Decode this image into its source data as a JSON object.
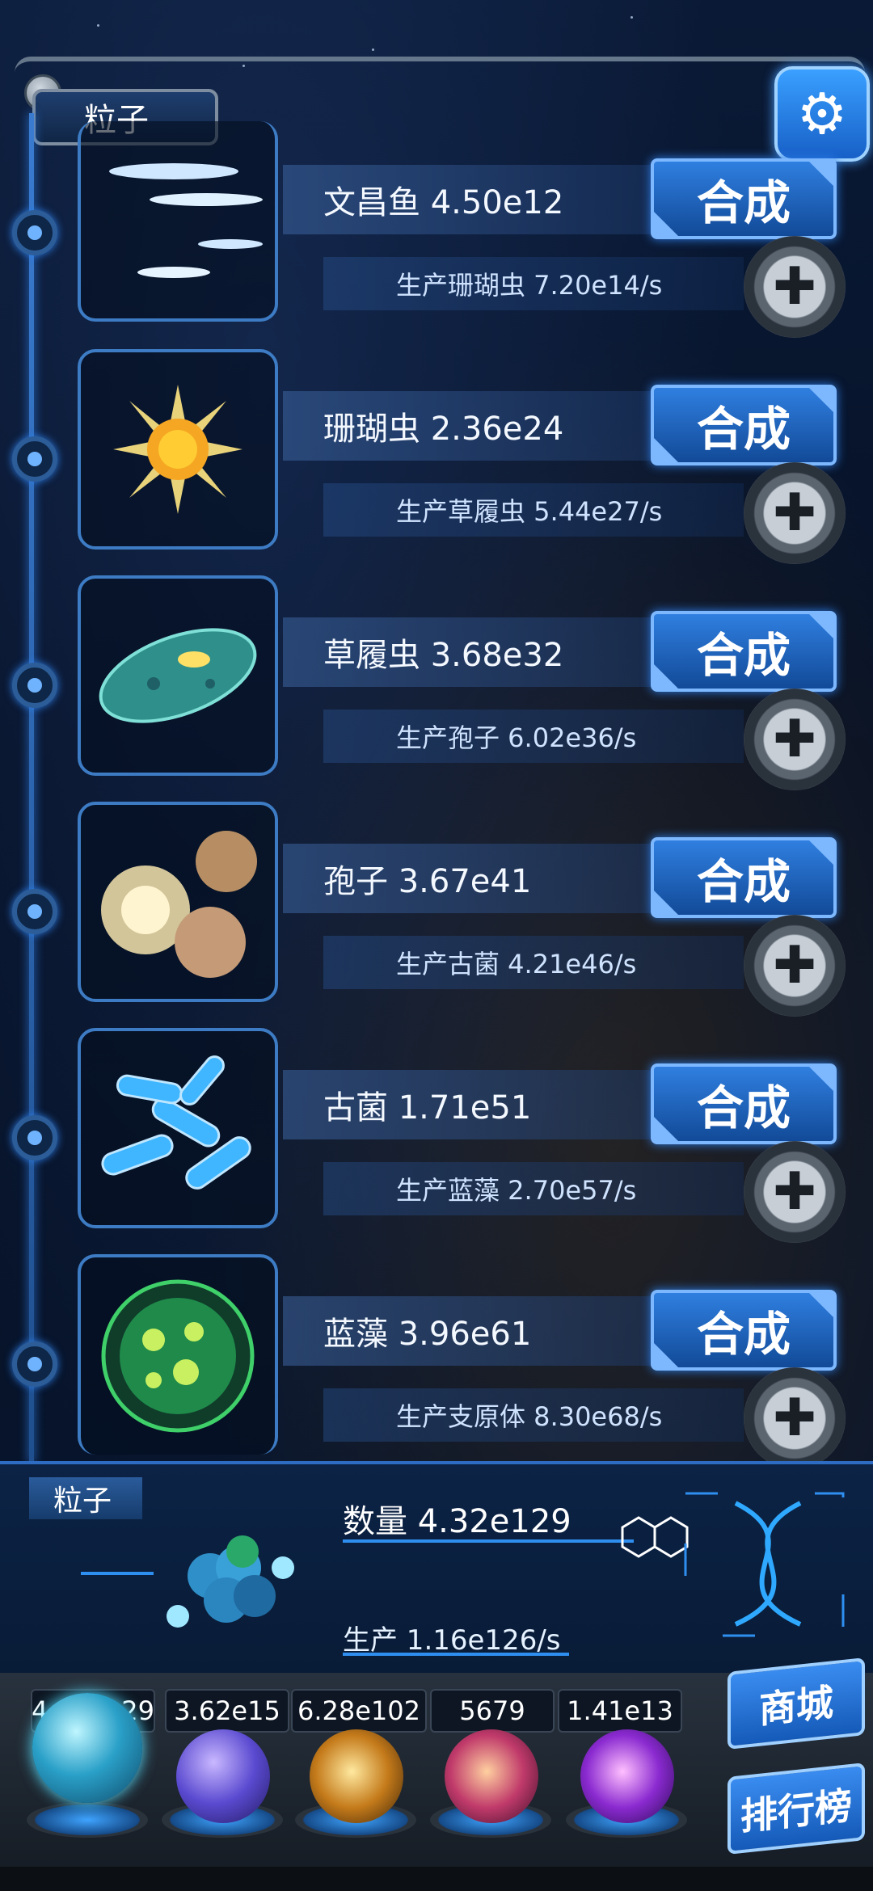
{
  "header": {
    "title": "粒子"
  },
  "rows": [
    {
      "name": "文昌鱼 4.50e12",
      "craft": "合成",
      "prod": "生产珊瑚虫 7.20e14/s"
    },
    {
      "name": "珊瑚虫 2.36e24",
      "craft": "合成",
      "prod": "生产草履虫 5.44e27/s"
    },
    {
      "name": "草履虫 3.68e32",
      "craft": "合成",
      "prod": "生产孢子 6.02e36/s"
    },
    {
      "name": "孢子 3.67e41",
      "craft": "合成",
      "prod": "生产古菌 4.21e46/s"
    },
    {
      "name": "古菌 1.71e51",
      "craft": "合成",
      "prod": "生产蓝藻 2.70e57/s"
    },
    {
      "name": "蓝藻 3.96e61",
      "craft": "合成",
      "prod": "生产支原体 8.30e68/s"
    }
  ],
  "summary": {
    "label": "粒子",
    "count": "数量 4.32e129",
    "production": "生产 1.16e126/s"
  },
  "resources": [
    {
      "value": "4.32e129",
      "icon": "particle-orb-icon"
    },
    {
      "value": "3.62e15",
      "icon": "lightning-orb-icon"
    },
    {
      "value": "6.28e102",
      "icon": "galaxy-orb-icon"
    },
    {
      "value": "5679",
      "icon": "brain-orb-icon"
    },
    {
      "value": "1.41e13",
      "icon": "vortex-orb-icon"
    }
  ],
  "side": {
    "shop": "商城",
    "rank": "排行榜"
  }
}
